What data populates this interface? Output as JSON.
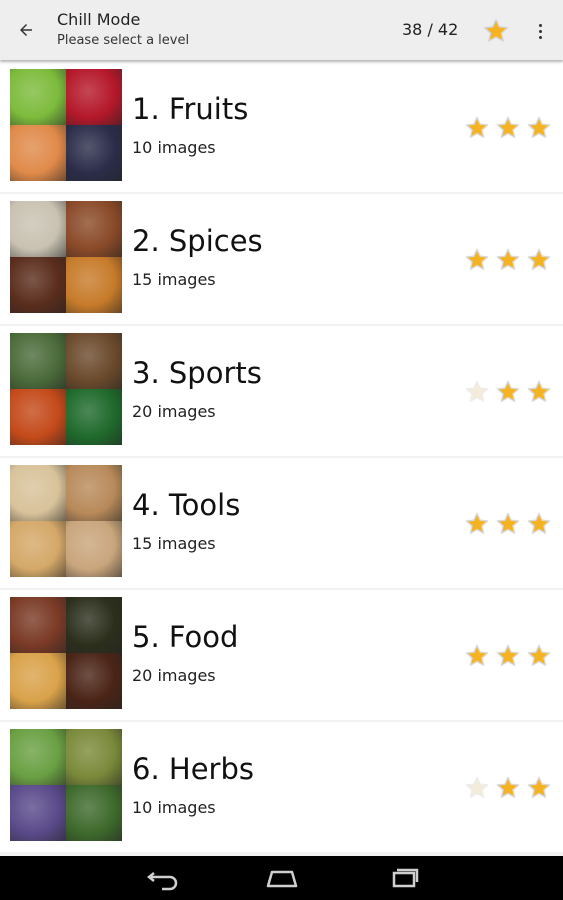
{
  "app_bar": {
    "title": "Chill Mode",
    "subtitle": "Please select a level",
    "score": "38 / 42",
    "back_icon": "arrow-back-icon",
    "star_icon": "star-icon",
    "menu_icon": "more-vert-icon"
  },
  "colors": {
    "star_gold": "#f5b323",
    "star_empty": "#f3ecd9",
    "app_bar_bg": "#eeeeee"
  },
  "levels": [
    {
      "title": "1. Fruits",
      "count": "10 images",
      "stars": 3,
      "tiles": [
        "#7dbb3c",
        "#b5182a",
        "#e08a4a",
        "#2b2d4a"
      ]
    },
    {
      "title": "2. Spices",
      "count": "15 images",
      "stars": 3,
      "tiles": [
        "#c9c2b2",
        "#8a4a28",
        "#5a2d1c",
        "#c77b2a"
      ]
    },
    {
      "title": "3. Sports",
      "count": "20 images",
      "stars": 2,
      "tiles": [
        "#4b6b3a",
        "#6b4a2c",
        "#c44a1a",
        "#1f6a2c"
      ]
    },
    {
      "title": "4. Tools",
      "count": "15 images",
      "stars": 3,
      "tiles": [
        "#d8c29a",
        "#b88a5a",
        "#d4a868",
        "#c9a57c"
      ]
    },
    {
      "title": "5. Food",
      "count": "20 images",
      "stars": 3,
      "tiles": [
        "#7a3a26",
        "#2c2f1c",
        "#d9a24a",
        "#4a2416"
      ]
    },
    {
      "title": "6. Herbs",
      "count": "10 images",
      "stars": 2,
      "tiles": [
        "#6aa043",
        "#7a8a3a",
        "#5a4a8a",
        "#3e6a2c"
      ]
    }
  ],
  "nav_bar": {
    "back_icon": "nav-back-icon",
    "home_icon": "nav-home-icon",
    "recents_icon": "nav-recents-icon"
  }
}
